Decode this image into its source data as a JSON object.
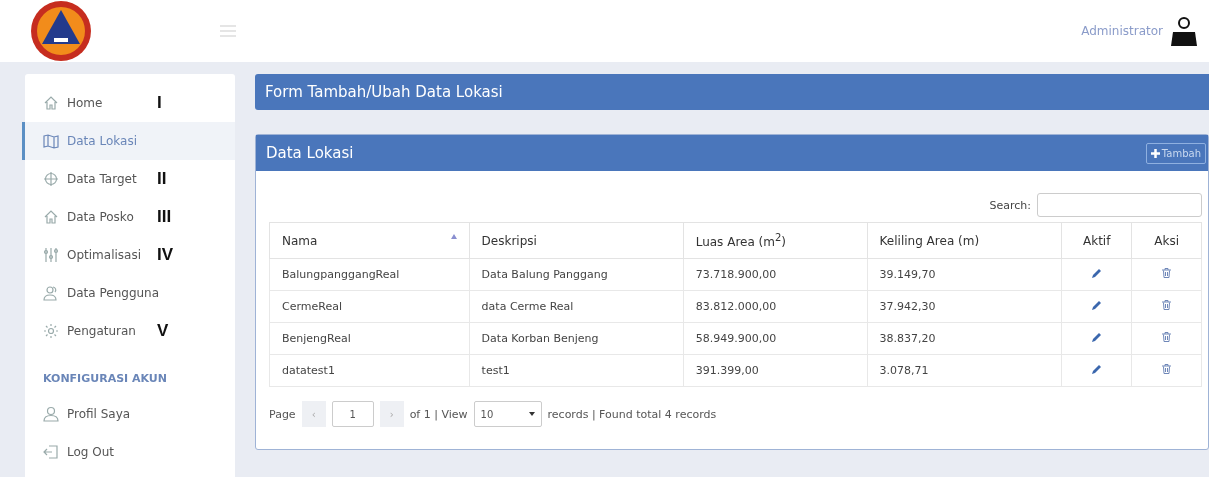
{
  "header": {
    "user": "Administrator"
  },
  "sidebar": {
    "items": [
      {
        "label": "Home",
        "selected": false,
        "annotation": "I"
      },
      {
        "label": "Data Lokasi",
        "selected": true
      },
      {
        "label": "Data Target",
        "selected": false,
        "annotation": "II"
      },
      {
        "label": "Data Posko",
        "selected": false,
        "annotation": "III"
      },
      {
        "label": "Optimalisasi",
        "selected": false,
        "annotation": "IV"
      },
      {
        "label": "Data Pengguna",
        "selected": false
      },
      {
        "label": "Pengaturan",
        "selected": false,
        "annotation": "V"
      }
    ],
    "section": "KONFIGURASI AKUN",
    "account_items": [
      {
        "label": "Profil Saya",
        "selected": false
      },
      {
        "label": "Log Out",
        "selected": false
      }
    ]
  },
  "form_panel": {
    "title": "Form Tambah/Ubah Data Lokasi"
  },
  "data_panel": {
    "title": "Data Lokasi",
    "add_button": "Tambah",
    "search_label": "Search:",
    "table": {
      "columns": [
        "Nama",
        "Deskripsi",
        "Luas Area (m$^{2}$)",
        "Keliling Area (m)",
        "Aktif",
        "Aksi"
      ],
      "rows": [
        [
          "BalungpanggangReal",
          "Data Balung Panggang",
          "73.718.900,00",
          "39.149,70"
        ],
        [
          "CermeReal",
          "data Cerme Real",
          "83.812.000,00",
          "37.942,30"
        ],
        [
          "BenjengReal",
          "Data Korban Benjeng",
          "58.949.900,00",
          "38.837,20"
        ],
        [
          "datatest1",
          "test1",
          "391.399,00",
          "3.078,71"
        ]
      ]
    },
    "pager": {
      "page_label": "Page",
      "prev": "‹",
      "page": "1",
      "next": "›",
      "of_text": "of 1 | View",
      "per_page": "10",
      "records_text": "records | Found total 4 records"
    }
  }
}
